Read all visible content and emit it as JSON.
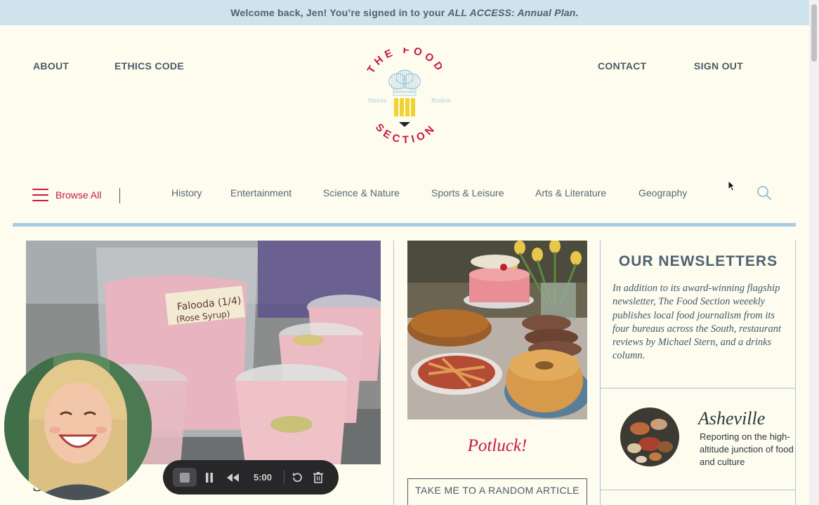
{
  "banner": {
    "text": "Welcome back, Jen! You’re signed in to your",
    "plan": "ALL ACCESS: Annual Plan."
  },
  "nav": {
    "about": "ABOUT",
    "ethics": "ETHICS CODE",
    "contact": "CONTACT",
    "signout": "SIGN OUT"
  },
  "logo": {
    "top_text": "THE FOOD",
    "bottom_text": "SECTION",
    "left_script": "Hanna",
    "right_script": "Raskin"
  },
  "browse": {
    "label": "Browse All"
  },
  "categories": [
    "History",
    "Entertainment",
    "Science & Nature",
    "Sports & Leisure",
    "Arts & Literature",
    "Geography"
  ],
  "hero": {
    "title": "S          ns are"
  },
  "potluck": {
    "title": "Potluck!",
    "button": "TAKE ME TO A RANDOM ARTICLE"
  },
  "newsletters": {
    "title": "OUR NEWSLETTERS",
    "description": "In addition to its award-winning flagship newsletter, The Food Section weeekly publishes local food journalism from its four bureaus across the South, restaurant reviews by Michael Stern, and a drinks column.",
    "asheville": {
      "title": "Asheville",
      "description": "Reporting on the high-altitude junction of food and culture"
    }
  },
  "recorder": {
    "time": "5:00"
  },
  "colors": {
    "banner_bg": "#cfe3ec",
    "page_bg": "#fdfcee",
    "brand_red": "#c8193e",
    "accent_blue": "#a9cbe0",
    "logo_yellow": "#f2d22e"
  },
  "icons": [
    "hamburger-icon",
    "search-icon",
    "cursor-icon",
    "stop-icon",
    "pause-icon",
    "rewind-icon",
    "restart-icon",
    "trash-icon"
  ]
}
